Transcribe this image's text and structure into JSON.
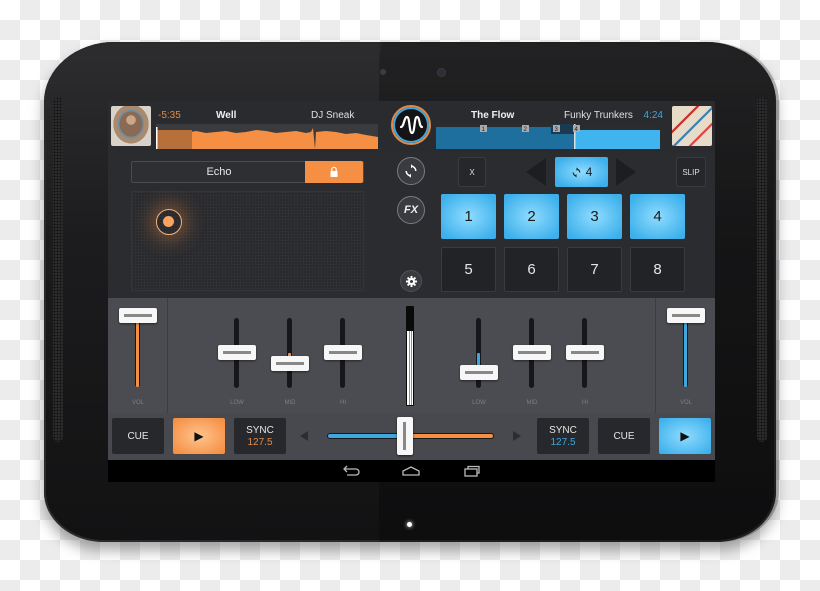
{
  "deck_left": {
    "time_remaining": "-5:35",
    "title": "Well",
    "artist": "DJ Sneak",
    "accent": "#f58f43",
    "play_label": "▶",
    "cue_label": "CUE",
    "sync_label": "SYNC",
    "bpm": "127.5",
    "eq": {
      "low": 0.5,
      "mid": 0.35,
      "hi": 0.5
    },
    "eq_labels": [
      "LOW",
      "MID",
      "HI"
    ],
    "vol_label": "VOL",
    "volume": 1.0,
    "playhead_progress": 0.16
  },
  "deck_right": {
    "time_remaining": "4:24",
    "title": "The Flow",
    "artist": "Funky Trunkers",
    "accent": "#3fa6de",
    "play_label": "▶",
    "cue_label": "CUE",
    "sync_label": "SYNC",
    "bpm": "127.5",
    "eq": {
      "low": 0.3,
      "mid": 0.5,
      "hi": 0.5
    },
    "eq_labels": [
      "LOW",
      "MID",
      "HI"
    ],
    "vol_label": "VOL",
    "volume": 1.0,
    "playhead_progress": 0.62,
    "cue_markers": [
      "1",
      "2",
      "3",
      "4"
    ]
  },
  "fx": {
    "effect_name": "Echo",
    "lock_icon": "lock-icon",
    "fx_label": "FX"
  },
  "loop": {
    "clear_label": "X",
    "size": "4",
    "slip_label": "SLIP"
  },
  "pads": [
    "1",
    "2",
    "3",
    "4",
    "5",
    "6",
    "7",
    "8"
  ],
  "mixer": {
    "master_level": 0.75,
    "crossfader": 0.47
  },
  "icons": {
    "logo": "waveform-logo-icon",
    "sync": "sync-icon",
    "settings": "gear-icon",
    "back": "back-icon",
    "home": "home-icon",
    "recents": "recents-icon"
  }
}
